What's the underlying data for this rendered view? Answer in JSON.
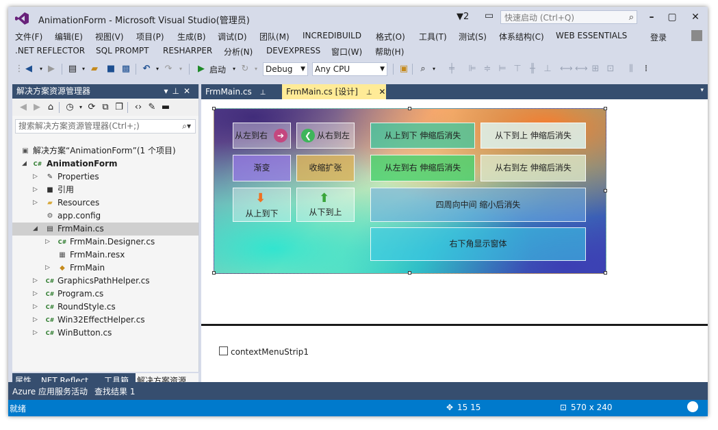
{
  "window": {
    "title": "AnimationForm - Microsoft Visual Studio(管理员)",
    "notification_count": "2",
    "quick_launch_placeholder": "快速启动 (Ctrl+Q)",
    "login_label": "登录"
  },
  "menu_row1": [
    "文件(F)",
    "编辑(E)",
    "视图(V)",
    "项目(P)",
    "生成(B)",
    "调试(D)",
    "团队(M)",
    "INCREDIBUILD",
    "格式(O)",
    "工具(T)",
    "测试(S)",
    "体系结构(C)",
    "WEB ESSENTIALS"
  ],
  "menu_row2": [
    ".NET REFLECTOR",
    "SQL PROMPT",
    "RESHARPER",
    "分析(N)",
    "DEVEXPRESS",
    "窗口(W)",
    "帮助(H)"
  ],
  "toolbar": {
    "start_label": "启动",
    "config": "Debug",
    "platform": "Any CPU"
  },
  "solution_explorer": {
    "title": "解决方案资源管理器",
    "search_placeholder": "搜索解决方案资源管理器(Ctrl+;)",
    "tree": [
      {
        "label": "解决方案“AnimationForm”(1 个项目)",
        "level": 0,
        "icon": "solution-icon",
        "expander": ""
      },
      {
        "label": "AnimationForm",
        "level": 1,
        "icon": "csharp-project-icon",
        "expander": "expanded",
        "bold": true
      },
      {
        "label": "Properties",
        "level": 2,
        "icon": "wrench-icon",
        "expander": "collapsed"
      },
      {
        "label": "引用",
        "level": 2,
        "icon": "references-icon",
        "expander": "collapsed"
      },
      {
        "label": "Resources",
        "level": 2,
        "icon": "folder-icon",
        "expander": "collapsed"
      },
      {
        "label": "app.config",
        "level": 2,
        "icon": "config-file-icon",
        "expander": ""
      },
      {
        "label": "FrmMain.cs",
        "level": 2,
        "icon": "form-icon",
        "expander": "expanded",
        "selected": true
      },
      {
        "label": "FrmMain.Designer.cs",
        "level": 3,
        "icon": "csharp-file-icon",
        "expander": "collapsed"
      },
      {
        "label": "FrmMain.resx",
        "level": 3,
        "icon": "resx-file-icon",
        "expander": ""
      },
      {
        "label": "FrmMain",
        "level": 3,
        "icon": "class-icon",
        "expander": "collapsed"
      },
      {
        "label": "GraphicsPathHelper.cs",
        "level": 2,
        "icon": "csharp-file-icon",
        "expander": "collapsed"
      },
      {
        "label": "Program.cs",
        "level": 2,
        "icon": "csharp-file-icon",
        "expander": "collapsed"
      },
      {
        "label": "RoundStyle.cs",
        "level": 2,
        "icon": "csharp-file-icon",
        "expander": "collapsed"
      },
      {
        "label": "Win32EffectHelper.cs",
        "level": 2,
        "icon": "csharp-file-icon",
        "expander": "collapsed"
      },
      {
        "label": "WinButton.cs",
        "level": 2,
        "icon": "csharp-file-icon",
        "expander": "collapsed"
      }
    ]
  },
  "tool_tabs": [
    "属性",
    ".NET Reflect...",
    "工具箱",
    "解决方案资源..."
  ],
  "doc_tabs": [
    {
      "label": "FrmMain.cs",
      "active": false
    },
    {
      "label": "FrmMain.cs [设计]",
      "active": true
    }
  ],
  "form_buttons": {
    "left_to_right": "从左到右",
    "right_to_left": "从右到左",
    "fade": "渐变",
    "shrink_expand": "收缩扩张",
    "top_to_bottom": "从上到下",
    "bottom_to_top": "从下到上",
    "top_to_bottom_shrink": "从上到下 伸缩后消失",
    "bottom_to_top_shrink": "从下到上  伸缩后消失",
    "left_to_right_shrink": "从左到右  伸缩后消失",
    "right_to_left_shrink": "从右到左  伸缩后消失",
    "center_shrink": "四周向中间 缩小后消失",
    "bottom_right_show": "右下角显示窗体"
  },
  "tray": {
    "component": "contextMenuStrip1"
  },
  "bottom_panels": [
    "Azure 应用服务活动",
    "查找结果 1"
  ],
  "status": {
    "ready": "就绪",
    "position": "15   15",
    "size": "570 x 240"
  }
}
